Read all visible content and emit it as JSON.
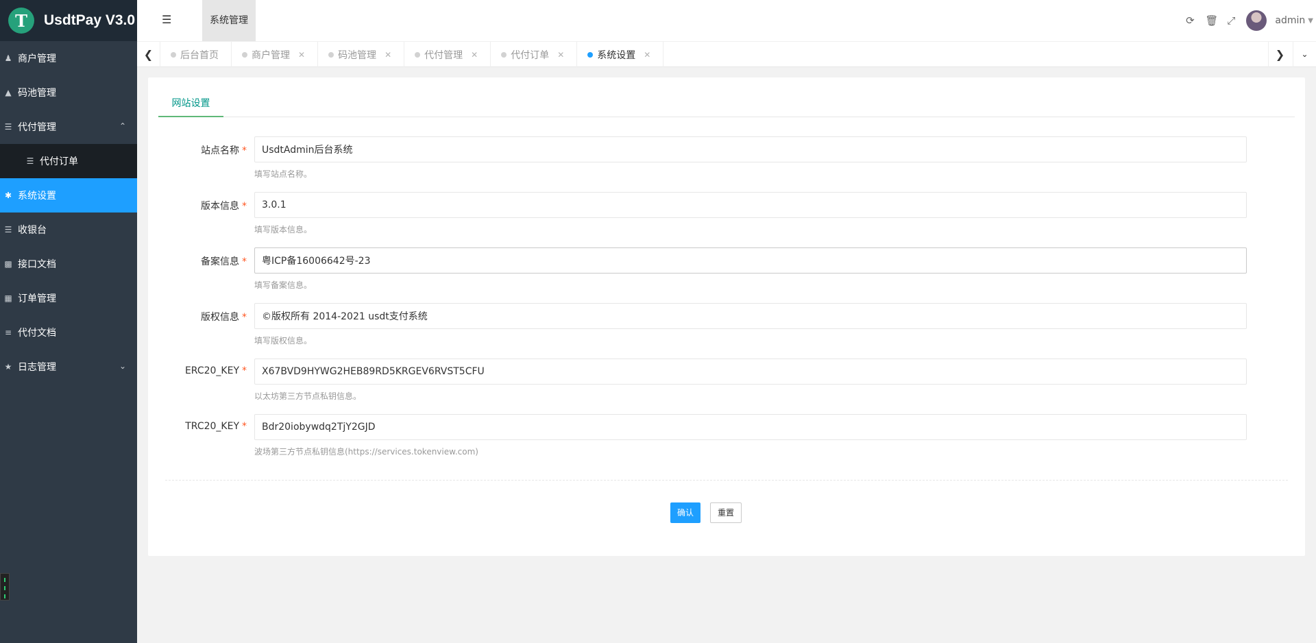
{
  "app": {
    "title": "UsdtPay V3.0",
    "logo_glyph": "T"
  },
  "sidebar": {
    "items": [
      {
        "label": "商户管理",
        "icon": "user-icon"
      },
      {
        "label": "码池管理",
        "icon": "android-icon"
      },
      {
        "label": "代付管理",
        "icon": "list-icon",
        "expanded": true
      },
      {
        "label": "代付订单",
        "icon": "list-icon",
        "sub": true
      },
      {
        "label": "系统设置",
        "icon": "gear-icon",
        "active": true
      },
      {
        "label": "收银台",
        "icon": "list-icon"
      },
      {
        "label": "接口文档",
        "icon": "book-icon"
      },
      {
        "label": "订单管理",
        "icon": "calculator-icon"
      },
      {
        "label": "代付文档",
        "icon": "align-left-icon"
      },
      {
        "label": "日志管理",
        "icon": "tree-icon",
        "expandable": true
      }
    ],
    "active_color": "#1e9fff"
  },
  "header": {
    "nav_label": "系统管理",
    "user": "admin"
  },
  "tabs": [
    {
      "label": "后台首页",
      "closable": false
    },
    {
      "label": "商户管理",
      "closable": true
    },
    {
      "label": "码池管理",
      "closable": true
    },
    {
      "label": "代付管理",
      "closable": true
    },
    {
      "label": "代付订单",
      "closable": true
    },
    {
      "label": "系统设置",
      "closable": true,
      "active": true
    }
  ],
  "settings": {
    "tab_label": "网站设置",
    "fields": [
      {
        "label": "站点名称",
        "value": "UsdtAdmin后台系统",
        "help": "填写站点名称。",
        "required": true
      },
      {
        "label": "版本信息",
        "value": "3.0.1",
        "help": "填写版本信息。",
        "required": true
      },
      {
        "label": "备案信息",
        "value": "粤ICP备16006642号-23",
        "help": "填写备案信息。",
        "required": true
      },
      {
        "label": "版权信息",
        "value": "©版权所有 2014-2021 usdt支付系统",
        "help": "填写版权信息。",
        "required": true
      },
      {
        "label": "ERC20_KEY",
        "value": "X67BVD9HYWG2HEB89RD5KRGEV6RVST5CFU",
        "help": "以太坊第三方节点私钥信息。",
        "required": true
      },
      {
        "label": "TRC20_KEY",
        "value": "Bdr20iobywdq2TjY2GJD",
        "help": "波场第三方节点私钥信息(https://services.tokenview.com)",
        "required": true
      }
    ],
    "required_mark": "*",
    "confirm_label": "确认",
    "reset_label": "重置"
  }
}
